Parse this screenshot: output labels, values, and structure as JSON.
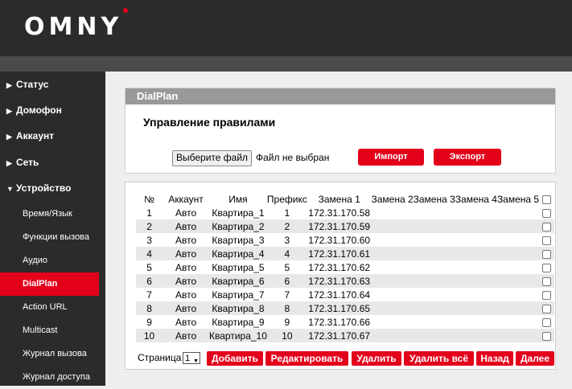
{
  "header": {
    "logo": "OMNY"
  },
  "sidebar": {
    "top_items": [
      {
        "label": "Статус",
        "arrow": "▶"
      },
      {
        "label": "Домофон",
        "arrow": "▶"
      },
      {
        "label": "Аккаунт",
        "arrow": "▶"
      },
      {
        "label": "Сеть",
        "arrow": "▶"
      },
      {
        "label": "Устройство",
        "arrow": "▼"
      }
    ],
    "sub_items": [
      "Время/Язык",
      "Функции вызова",
      "Аудио",
      "DialPlan",
      "Action URL",
      "Multicast",
      "Журнал вызова",
      "Журнал доступа"
    ],
    "active_sub": "DialPlan"
  },
  "panel": {
    "title": "DialPlan",
    "section_title": "Управление правилами",
    "file_button": "Выберите файл",
    "file_status": "Файл не выбран",
    "import_label": "Импорт",
    "export_label": "Экспорт"
  },
  "table": {
    "columns": [
      "№",
      "Аккаунт",
      "Имя",
      "Префикс",
      "Замена 1",
      "Замена 2",
      "Замена 3",
      "Замена 4",
      "Замена 5"
    ],
    "rows": [
      {
        "n": "1",
        "account": "Авто",
        "name": "Квартира_1",
        "prefix": "1",
        "r1": "172.31.170.58"
      },
      {
        "n": "2",
        "account": "Авто",
        "name": "Квартира_2",
        "prefix": "2",
        "r1": "172.31.170.59"
      },
      {
        "n": "3",
        "account": "Авто",
        "name": "Квартира_3",
        "prefix": "3",
        "r1": "172.31.170.60"
      },
      {
        "n": "4",
        "account": "Авто",
        "name": "Квартира_4",
        "prefix": "4",
        "r1": "172.31.170.61"
      },
      {
        "n": "5",
        "account": "Авто",
        "name": "Квартира_5",
        "prefix": "5",
        "r1": "172.31.170.62"
      },
      {
        "n": "6",
        "account": "Авто",
        "name": "Квартира_6",
        "prefix": "6",
        "r1": "172.31.170.63"
      },
      {
        "n": "7",
        "account": "Авто",
        "name": "Квартира_7",
        "prefix": "7",
        "r1": "172.31.170.64"
      },
      {
        "n": "8",
        "account": "Авто",
        "name": "Квартира_8",
        "prefix": "8",
        "r1": "172.31.170.65"
      },
      {
        "n": "9",
        "account": "Авто",
        "name": "Квартира_9",
        "prefix": "9",
        "r1": "172.31.170.66"
      },
      {
        "n": "10",
        "account": "Авто",
        "name": "Квартира_10",
        "prefix": "10",
        "r1": "172.31.170.67"
      }
    ]
  },
  "pagination": {
    "page_label": "Страница",
    "page_value": "1",
    "add": "Добавить",
    "edit": "Редактировать",
    "delete": "Удалить",
    "delete_all": "Удалить всё",
    "back": "Назад",
    "next": "Далее"
  },
  "colors": {
    "accent": "#e3001b",
    "header_bg": "#2b2b2b",
    "panel_title_bg": "#999999"
  }
}
